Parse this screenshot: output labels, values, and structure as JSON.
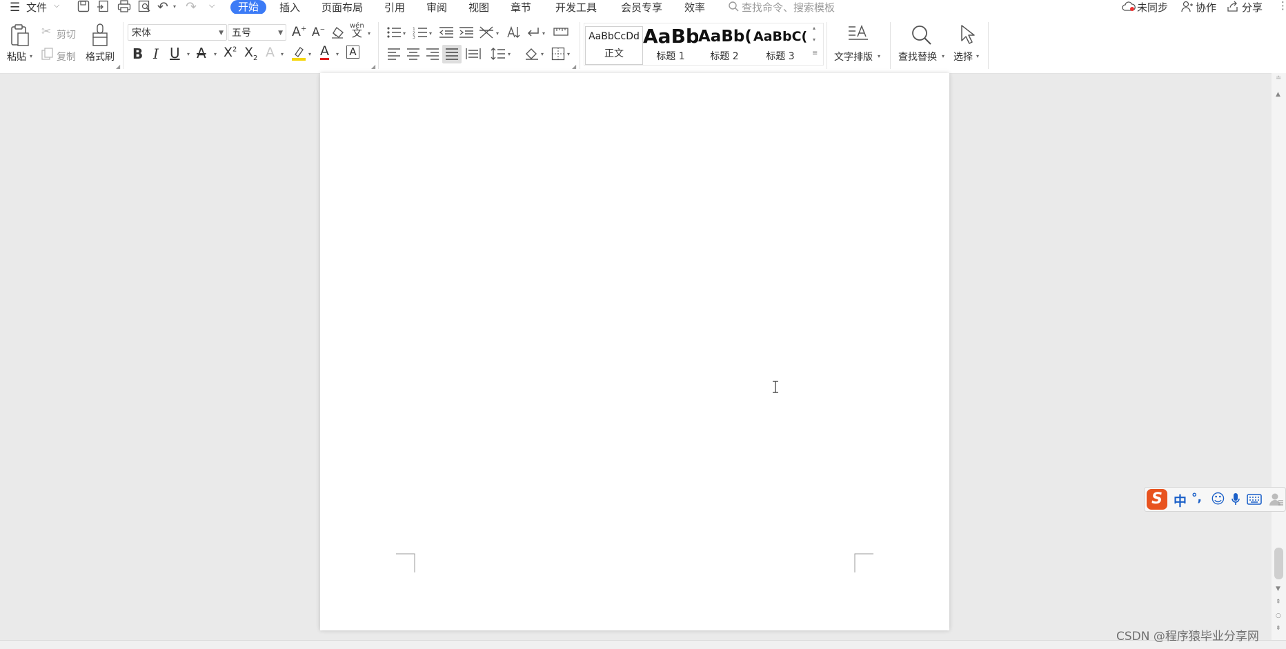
{
  "menu": {
    "file_label": "文件",
    "tabs": [
      "开始",
      "插入",
      "页面布局",
      "引用",
      "审阅",
      "视图",
      "章节",
      "开发工具",
      "会员专享",
      "效率"
    ],
    "search_placeholder": "查找命令、搜索模板",
    "right": {
      "sync": "未同步",
      "collab": "协作",
      "share": "分享"
    }
  },
  "clipboard": {
    "paste": "粘贴",
    "cut": "剪切",
    "copy": "复制",
    "format_painter": "格式刷"
  },
  "font": {
    "name": "宋体",
    "size": "五号",
    "phonetic": "wén"
  },
  "styles": [
    {
      "preview": "AaBbCcDd",
      "label": "正文"
    },
    {
      "preview": "AaBb",
      "label": "标题 1"
    },
    {
      "preview": "AaBb(",
      "label": "标题 2"
    },
    {
      "preview": "AaBbC(",
      "label": "标题 3"
    }
  ],
  "tools": {
    "text_layout": "文字排版",
    "find_replace": "查找替换",
    "select": "选择"
  },
  "ime": {
    "mode": "中",
    "punct": "°,"
  },
  "watermark": "CSDN @程序猿毕业分享网",
  "colors": {
    "accent": "#3c7bf6",
    "highlight": "#f5d60b",
    "font_color": "#e02020",
    "ime_logo": "#e8531f",
    "ime_icon": "#1a5fc8"
  }
}
